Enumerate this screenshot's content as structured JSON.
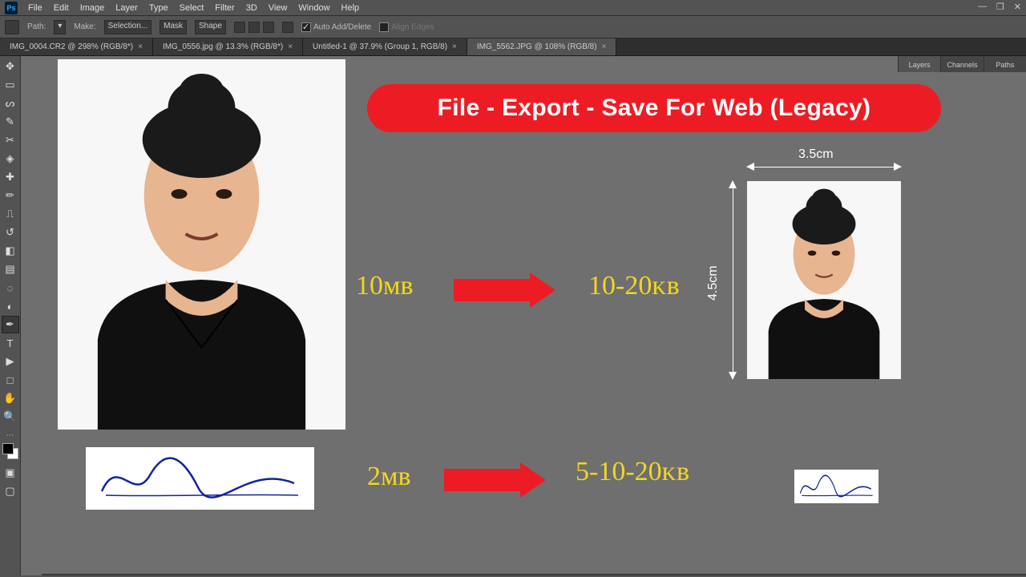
{
  "menu": {
    "items": [
      "File",
      "Edit",
      "Image",
      "Layer",
      "Type",
      "Select",
      "Filter",
      "3D",
      "View",
      "Window",
      "Help"
    ]
  },
  "options_bar": {
    "path_label": "Path:",
    "make_label": "Make:",
    "selection": "Selection...",
    "mask": "Mask",
    "shape": "Shape",
    "auto_add_delete": "Auto Add/Delete",
    "align_edges": "Align Edges"
  },
  "tabs": [
    {
      "label": "IMG_0004.CR2 @ 298% (RGB/8*)",
      "active": false
    },
    {
      "label": "IMG_0556.jpg @ 13.3% (RGB/8*)",
      "active": false
    },
    {
      "label": "Untitled-1 @ 37.9% (Group 1, RGB/8)",
      "active": false
    },
    {
      "label": "IMG_5562.JPG @ 108% (RGB/8)",
      "active": true
    }
  ],
  "right_panel": {
    "tabs": [
      "Layers",
      "Channels",
      "Paths"
    ],
    "active": 0
  },
  "tools": [
    {
      "name": "move-tool",
      "glyph": "✥"
    },
    {
      "name": "marquee-tool",
      "glyph": "▭"
    },
    {
      "name": "lasso-tool",
      "glyph": "ᔕ"
    },
    {
      "name": "quick-select-tool",
      "glyph": "✎"
    },
    {
      "name": "crop-tool",
      "glyph": "✂"
    },
    {
      "name": "eyedropper-tool",
      "glyph": "◈"
    },
    {
      "name": "healing-tool",
      "glyph": "✚"
    },
    {
      "name": "brush-tool",
      "glyph": "✏"
    },
    {
      "name": "stamp-tool",
      "glyph": "⎍"
    },
    {
      "name": "history-brush-tool",
      "glyph": "↺"
    },
    {
      "name": "eraser-tool",
      "glyph": "◧"
    },
    {
      "name": "gradient-tool",
      "glyph": "▤"
    },
    {
      "name": "blur-tool",
      "glyph": "◌"
    },
    {
      "name": "dodge-tool",
      "glyph": "◐"
    },
    {
      "name": "pen-tool",
      "glyph": "✒"
    },
    {
      "name": "type-tool",
      "glyph": "T"
    },
    {
      "name": "path-select-tool",
      "glyph": "▶"
    },
    {
      "name": "rectangle-tool",
      "glyph": "□"
    },
    {
      "name": "hand-tool",
      "glyph": "✋"
    },
    {
      "name": "zoom-tool",
      "glyph": "🔍"
    }
  ],
  "annotations": {
    "red_pill": "File - Export - Save For Web (Legacy)",
    "size_photo_before": "10ᴍʙ",
    "size_photo_after": "10-20ᴋʙ",
    "size_sig_before": "2ᴍʙ",
    "size_sig_after": "5-10-20ᴋʙ",
    "dim_w": "3.5cm",
    "dim_h": "4.5cm"
  }
}
